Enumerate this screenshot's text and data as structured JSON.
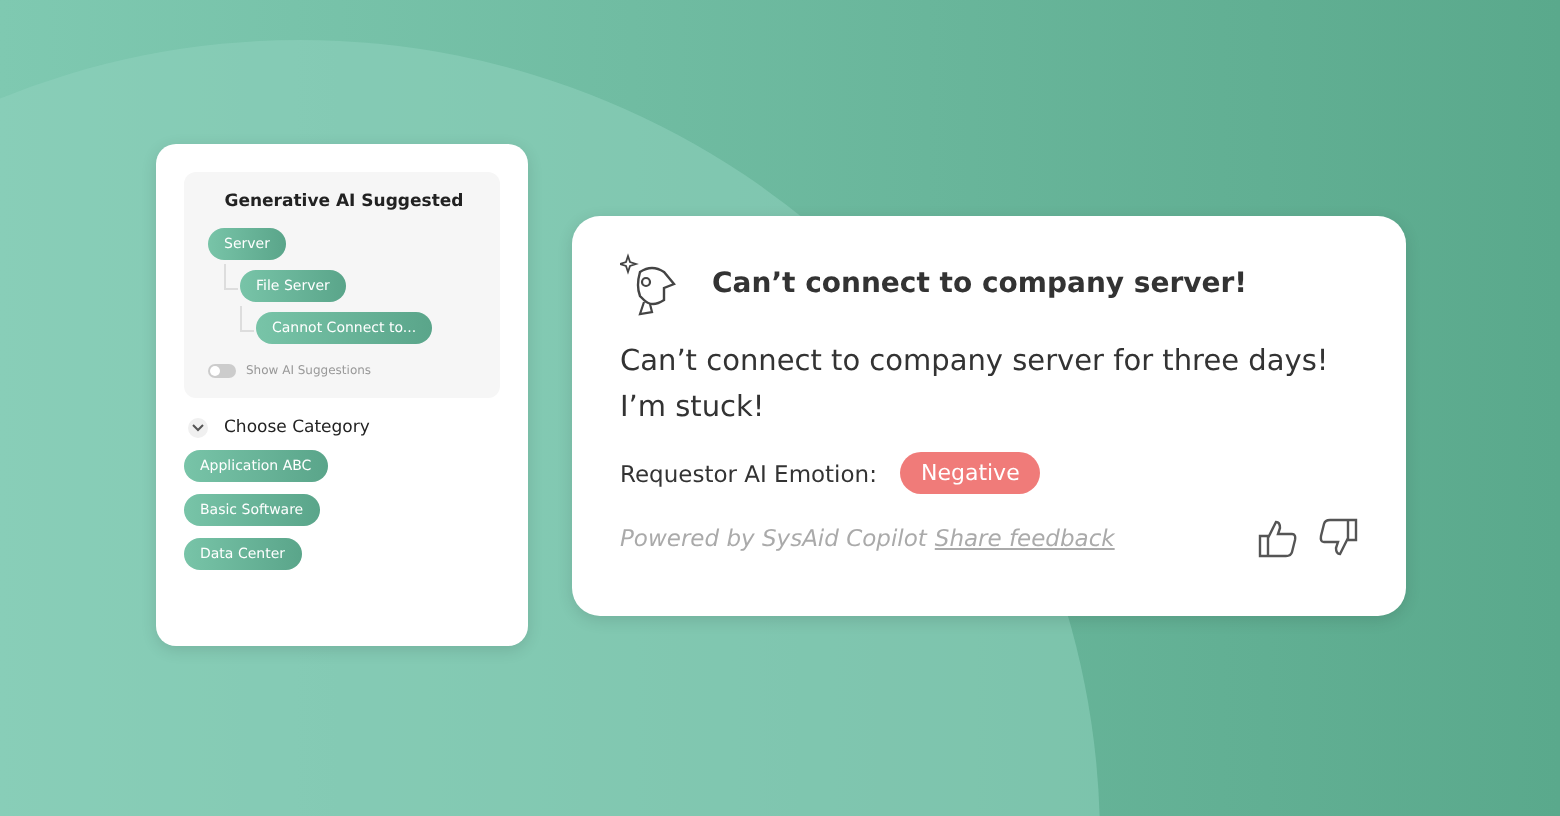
{
  "suggestions": {
    "title": "Generative AI Suggested",
    "tree": [
      {
        "label": "Server",
        "children": [
          {
            "label": "File Server",
            "children": [
              {
                "label": "Cannot Connect to..."
              }
            ]
          }
        ]
      }
    ],
    "toggle": {
      "label": "Show AI Suggestions",
      "on": false
    }
  },
  "category": {
    "title": "Choose Category",
    "expanded": true,
    "items": [
      "Application ABC",
      "Basic Software",
      "Data Center"
    ]
  },
  "ticket": {
    "title": "Can’t connect to company server!",
    "body": "Can’t connect to company server for three days! I’m stuck!",
    "emotion_label": "Requestor AI Emotion:",
    "emotion": "Negative",
    "powered": "Powered by SysAid Copilot",
    "feedback_link": "Share feedback"
  }
}
